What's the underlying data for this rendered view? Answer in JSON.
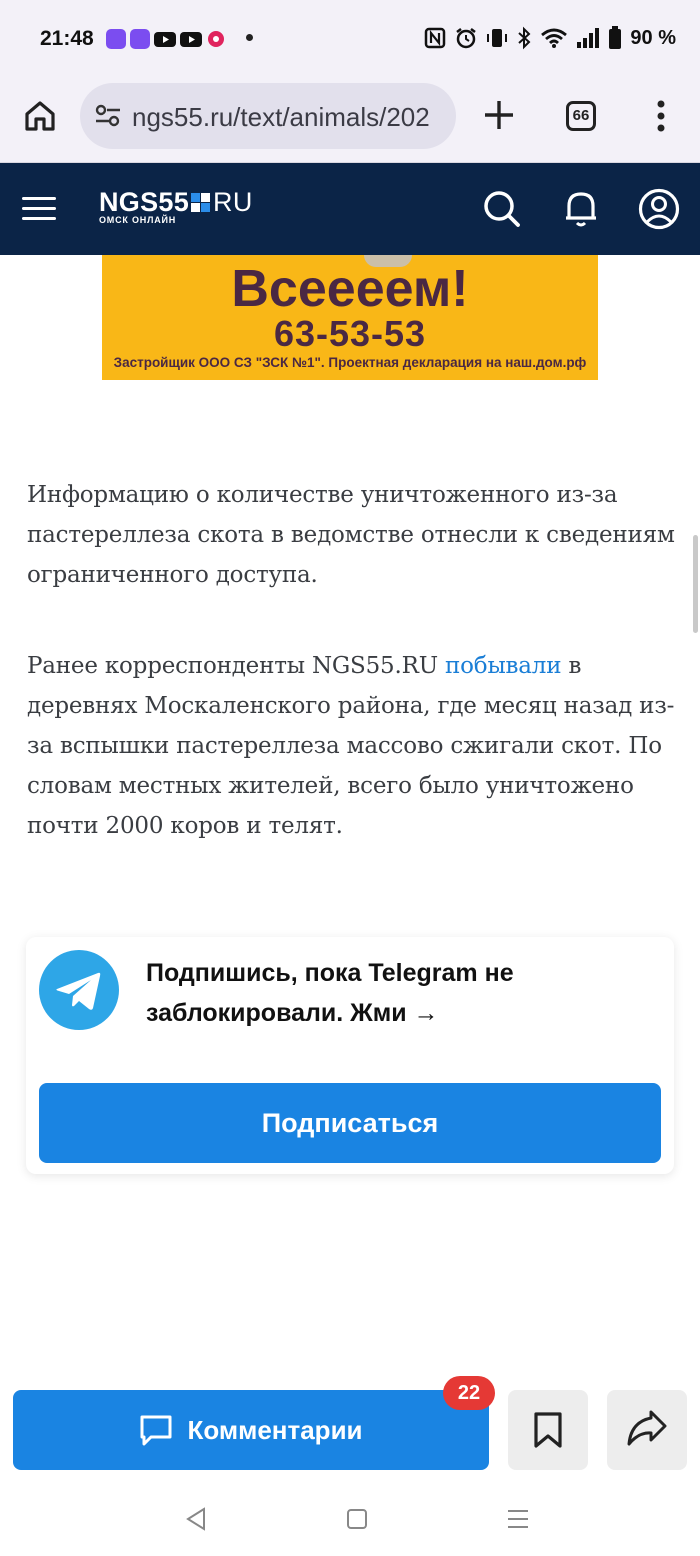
{
  "status_bar": {
    "time": "21:48",
    "battery": "90 %",
    "icons": [
      "app-icon",
      "app-icon",
      "youtube-icon",
      "youtube-icon",
      "music-icon",
      "notification-dot",
      "nfc-icon",
      "alarm-icon",
      "vibrate-icon",
      "bluetooth-icon",
      "wifi-icon",
      "signal-icon",
      "battery-icon"
    ]
  },
  "browser": {
    "url": "ngs55.ru/text/animals/202",
    "tab_count": "66"
  },
  "site": {
    "logo_main": "NGS55",
    "logo_ru": "RU",
    "logo_sub": "ОМСК ОНЛАЙН"
  },
  "ad": {
    "headline": "Всеееем!",
    "phone": "63-53-53",
    "legal": "Застройщик ООО СЗ \"ЗСК №1\". Проектная декларация на наш.дом.рф",
    "bg_color": "#f9b717"
  },
  "article": {
    "paragraph1": "Информацию о количестве уничтоженного из-за пастереллеза скота в ведомстве отнесли к сведениям ограниченного доступа.",
    "paragraph2_before": "Ранее корреспонденты NGS55.RU ",
    "paragraph2_link": "побывали",
    "paragraph2_after": " в деревнях Москаленского района, где месяц назад из-за вспышки пастереллеза массово сжигали скот. По словам местных жителей, всего было уничтожено почти 2000 коров и телят."
  },
  "telegram_card": {
    "text": "Подпишись, пока Telegram не заблокировали. Жми →",
    "button": "Подписаться"
  },
  "bottom_bar": {
    "comments_label": "Комментарии",
    "comments_count": "22"
  },
  "colors": {
    "header": "#0b2447",
    "accent": "#1a84e2",
    "link": "#1a7ed6",
    "badge": "#e53935"
  }
}
